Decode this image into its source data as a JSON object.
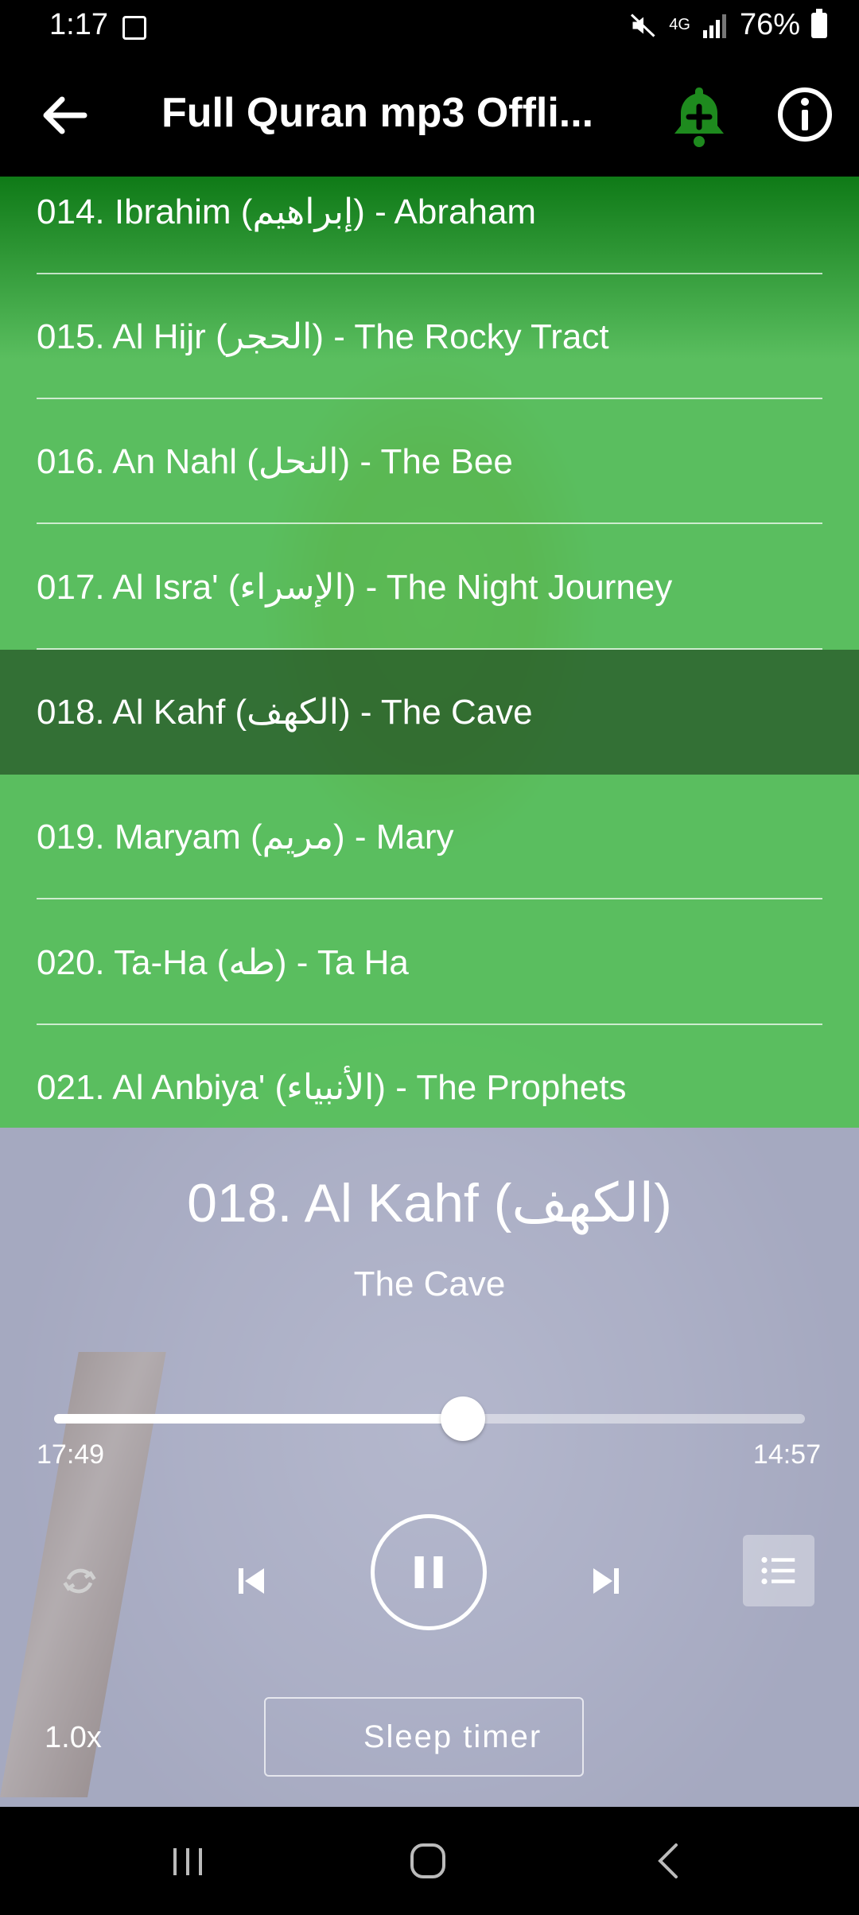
{
  "status_bar": {
    "time": "1:17",
    "signal_label": "4G",
    "battery": "76%"
  },
  "app_bar": {
    "title": "Full Quran mp3 Offli...",
    "icons": [
      "back-arrow-icon",
      "bell-add-icon",
      "info-icon"
    ],
    "bell_color": "#1e8a1e"
  },
  "playlist": {
    "accent": "#4cbe50",
    "active_index": 4,
    "tracks": [
      "014. Ibrahim (إبراهيم) - Abraham",
      "015. Al Hijr (الحجر) - The Rocky Tract",
      "016. An Nahl (النحل) - The Bee",
      "017. Al Isra' (الإسراء) - The Night Journey",
      "018. Al Kahf (الكهف) - The Cave",
      "019. Maryam (مريم) - Mary",
      "020. Ta-Ha (طه) - Ta Ha",
      "021. Al Anbiya' (الأنبياء) - The Prophets"
    ]
  },
  "player": {
    "title": "018. Al Kahf (الكهف)",
    "subtitle": "The Cave",
    "elapsed": "17:49",
    "total": "14:57",
    "progress_fraction": 0.544,
    "speed": "1.0x",
    "sleep_label": "Sleep timer",
    "icons": [
      "repeat-icon",
      "previous-icon",
      "pause-icon",
      "next-icon",
      "playlist-icon",
      "moon-icon"
    ]
  },
  "nav_bar": {
    "icons": [
      "recents-icon",
      "home-icon",
      "back-icon"
    ]
  }
}
